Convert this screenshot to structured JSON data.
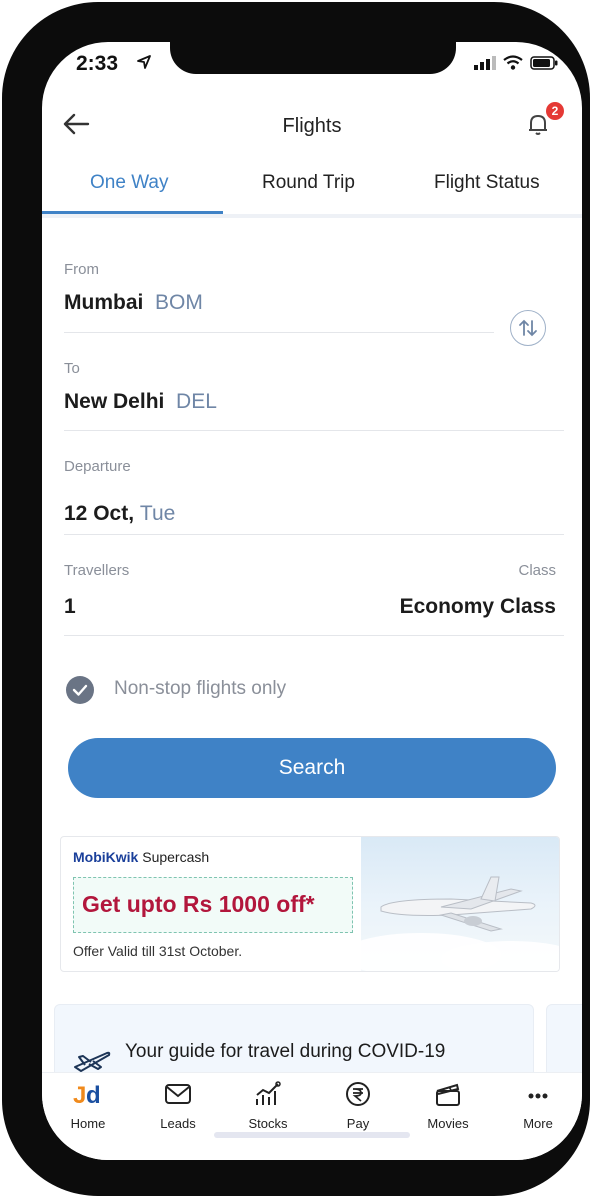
{
  "status": {
    "time": "2:33"
  },
  "header": {
    "title": "Flights",
    "notification_count": "2"
  },
  "tabs": [
    {
      "label": "One Way",
      "active": true
    },
    {
      "label": "Round Trip",
      "active": false
    },
    {
      "label": "Flight Status",
      "active": false
    }
  ],
  "form": {
    "from_label": "From",
    "from_city": "Mumbai",
    "from_code": "BOM",
    "to_label": "To",
    "to_city": "New Delhi",
    "to_code": "DEL",
    "departure_label": "Departure",
    "departure_date": "12 Oct,",
    "departure_day": "Tue",
    "travellers_label": "Travellers",
    "travellers_value": "1",
    "class_label": "Class",
    "class_value": "Economy Class",
    "nonstop_label": "Non-stop flights only",
    "nonstop_checked": true,
    "search_label": "Search"
  },
  "promo": {
    "brand_prefix": "M",
    "brand_rest": "obiKwik",
    "brand_suffix": "Supercash",
    "offer": "Get upto Rs 1000 off*",
    "valid": "Offer Valid till 31st October."
  },
  "guide": {
    "text": "Your guide for travel during COVID-19"
  },
  "nav": [
    {
      "label": "Home",
      "icon": "jd-logo-icon"
    },
    {
      "label": "Leads",
      "icon": "envelope-icon"
    },
    {
      "label": "Stocks",
      "icon": "stocks-chart-icon"
    },
    {
      "label": "Pay",
      "icon": "rupee-icon"
    },
    {
      "label": "Movies",
      "icon": "clapperboard-icon"
    },
    {
      "label": "More",
      "icon": "more-dots-icon"
    }
  ],
  "colors": {
    "accent": "#3f82c6",
    "offer_red": "#b2163c",
    "badge_red": "#e53935"
  }
}
